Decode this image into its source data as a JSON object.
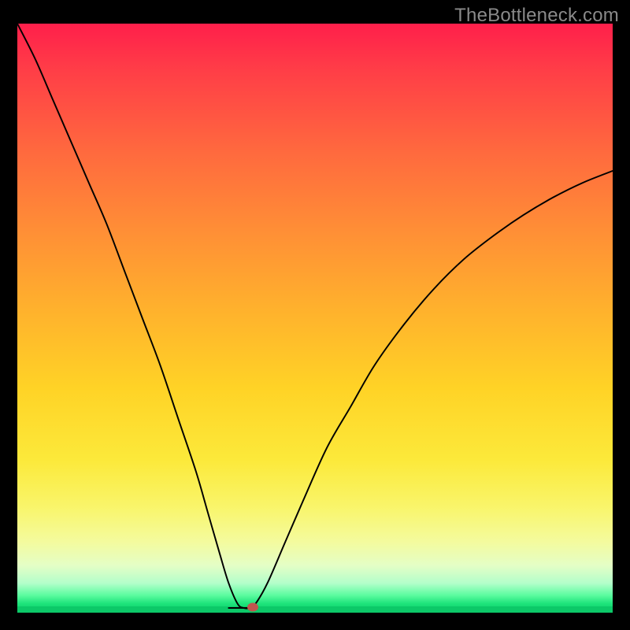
{
  "watermark": "TheBottleneck.com",
  "colors": {
    "frame": "#000000",
    "curve": "#000000",
    "marker": "#c0564e",
    "gradient_top": "#ff1f4b",
    "gradient_bottom": "#0cc968"
  },
  "chart_data": {
    "type": "line",
    "title": "",
    "xlabel": "",
    "ylabel": "",
    "xlim_pct": [
      0,
      100
    ],
    "ylim_pct": [
      0,
      100
    ],
    "note": "Values are expressed as percentages of the plot's interior width (x) and height (y). y=0 is the bottom edge, y=100 is the top edge.",
    "series": [
      {
        "name": "bottleneck-curve",
        "x_pct": [
          0,
          3,
          6,
          9,
          12,
          15,
          18,
          21,
          24,
          27,
          30,
          32,
          34,
          35.5,
          37,
          38,
          39,
          40,
          42,
          45,
          48,
          52,
          56,
          60,
          65,
          70,
          75,
          80,
          85,
          90,
          95,
          100
        ],
        "y_pct": [
          100,
          94,
          87,
          80,
          73,
          66,
          58,
          50,
          42,
          33,
          24,
          17,
          10,
          5,
          1.5,
          0.8,
          0.8,
          1.5,
          5,
          12,
          19,
          28,
          35,
          42,
          49,
          55,
          60,
          64,
          67.5,
          70.5,
          73,
          75
        ]
      },
      {
        "name": "floor-segment-left",
        "x_pct": [
          35.5,
          39.5
        ],
        "y_pct": [
          0.8,
          0.8
        ]
      }
    ],
    "marker": {
      "x_pct": 39.5,
      "y_pct": 1.0
    }
  }
}
